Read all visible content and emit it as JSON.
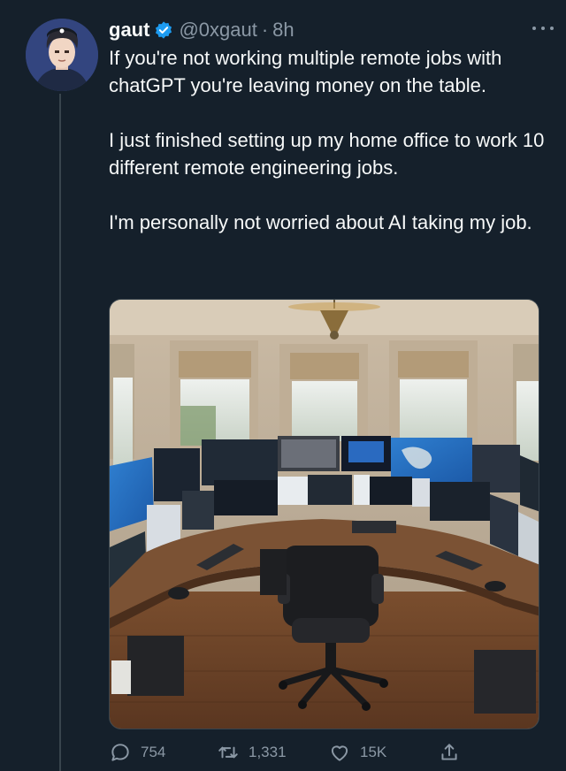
{
  "tweet": {
    "author_name": "gaut",
    "handle": "@0xgaut",
    "separator": "·",
    "timestamp": "8h",
    "paragraphs": [
      "If you're not working multiple remote jobs with chatGPT you're leaving money on the table.",
      "I just finished setting up my home office to work 10 different remote engineering jobs.",
      "I'm personally not worried about AI taking my job."
    ],
    "media": {
      "kind": "photo",
      "subject": "home-office"
    }
  },
  "actions": {
    "replies": "754",
    "retweets": "1,331",
    "likes": "15K"
  },
  "icons": {
    "verified": "verified-badge-icon",
    "more": "more-options-icon",
    "reply": "reply-icon",
    "retweet": "retweet-icon",
    "like": "heart-icon",
    "share": "share-icon"
  },
  "colors": {
    "background": "#15202b",
    "text": "#f7f9f9",
    "secondary_text": "#8b98a5",
    "verified": "#1d9bf0",
    "divider": "#38444d"
  }
}
